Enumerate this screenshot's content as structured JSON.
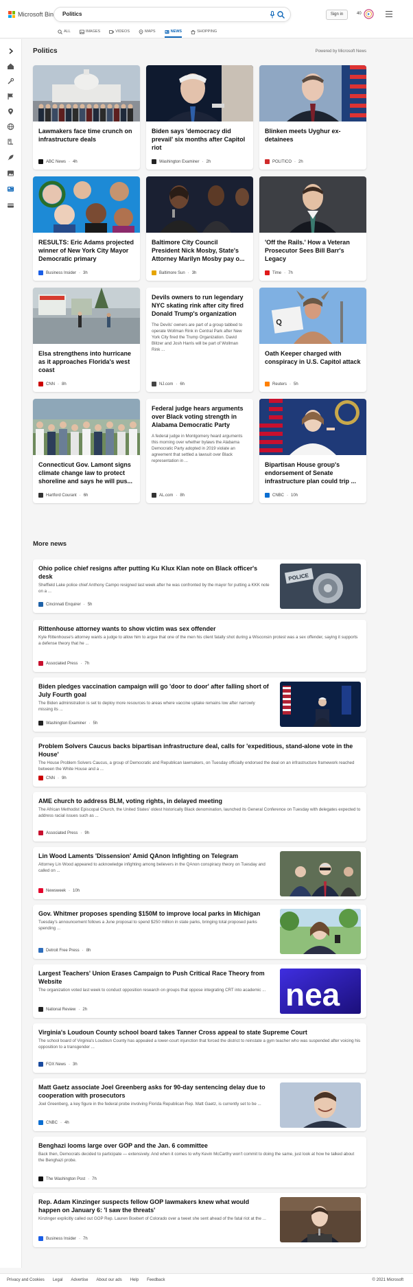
{
  "header": {
    "logo_text": "Microsoft Bing",
    "search_value": "Politics",
    "signin_label": "Sign in",
    "rewards_count": "40",
    "tabs": [
      {
        "label": "ALL",
        "icon": "search-icon"
      },
      {
        "label": "IMAGES",
        "icon": "image-icon"
      },
      {
        "label": "VIDEOS",
        "icon": "video-icon"
      },
      {
        "label": "MAPS",
        "icon": "map-pin-icon"
      },
      {
        "label": "NEWS",
        "icon": "news-icon",
        "active": true
      },
      {
        "label": "SHOPPING",
        "icon": "shopping-bag-icon"
      }
    ]
  },
  "colors": {
    "accent": "#0d66b8",
    "ms_red": "#f25022",
    "ms_green": "#7fba00",
    "ms_blue": "#00a4ef",
    "ms_yellow": "#ffb900"
  },
  "rail_icons": [
    "chevron-right-icon",
    "home-icon",
    "tools-icon",
    "flag-icon",
    "location-icon",
    "globe-icon",
    "education-icon",
    "rocket-icon",
    "gallery-icon",
    "news-icon",
    "card-icon"
  ],
  "section": {
    "title": "Politics",
    "powered_by": "Powered by Microsoft News"
  },
  "cards": [
    {
      "title": "Lawmakers face time crunch on infrastructure deals",
      "source": "ABC News",
      "time": "4h",
      "image": "capitol-group-photo"
    },
    {
      "title": "Biden says 'democracy did prevail' six months after Capitol riot",
      "source": "Washington Examiner",
      "time": "2h",
      "image": "biden-speaking-photo"
    },
    {
      "title": "Blinken meets Uyghur ex-detainees",
      "source": "POLITICO",
      "time": "2h",
      "image": "blinken-photo"
    },
    {
      "title": "RESULTS: Eric Adams projected winner of New York City Mayor Democratic primary",
      "source": "Business Insider",
      "time": "3h",
      "image": "candidates-collage"
    },
    {
      "title": "Baltimore City Council President Nick Mosby, State's Attorney Marilyn Mosby pay o...",
      "source": "Baltimore Sun",
      "time": "3h",
      "image": "mosby-podium-photo"
    },
    {
      "title": "'Off the Rails.' How a Veteran Prosecutor Sees Bill Barr's Legacy",
      "source": "Time",
      "time": "7h",
      "image": "man-in-suit-photo"
    },
    {
      "title": "Elsa strengthens into hurricane as it approaches Florida's west coast",
      "source": "CNN",
      "time": "8h",
      "image": "flooded-street-photo"
    },
    {
      "title": "Devils owners to run legendary NYC skating rink after city fired Donald Trump's organization",
      "snippet": "The Devils' owners are part of a group tabbed to operate Wollman Rink in Central Park after New York City fired the Trump Organization. David Blitzer and Josh Harris will be part of Wollman Rink ...",
      "source": "NJ.com",
      "time": "6h"
    },
    {
      "title": "Oath Keeper charged with conspiracy in U.S. Capitol attack",
      "source": "Reuters",
      "time": "5h",
      "image": "protester-horns-photo"
    },
    {
      "title": "Connecticut Gov. Lamont signs climate change law to protect shoreline and says he will pus...",
      "source": "Hartford Courant",
      "time": "6h",
      "image": "outdoor-group-photo"
    },
    {
      "title": "Federal judge hears arguments over Black voting strength in Alabama Democratic Party",
      "snippet": "A federal judge in Montgomery heard arguments this morning over whether bylaws the Alabama Democratic Party adopted in 2019 violate an agreement that settled a lawsuit over Black representation in ...",
      "source": "AL.com",
      "time": "8h"
    },
    {
      "title": "Bipartisan House group's endorsement of Senate infrastructure plan could trip ...",
      "source": "CNBC",
      "time": "10h",
      "image": "pelosi-photo"
    }
  ],
  "more_news": {
    "title": "More news",
    "items": [
      {
        "title": "Ohio police chief resigns after putting Ku Klux Klan note on Black officer's desk",
        "snippet": "Sheffield Lake police chief Anthony Campo resigned last week after he was confronted by the mayor for putting a KKK note on a ...",
        "source": "Cincinnati Enquirer",
        "time": "5h",
        "image": "police-badge-photo"
      },
      {
        "title": "Rittenhouse attorney wants to show victim was sex offender",
        "snippet": "Kyle Rittenhouse's attorney wants a judge to allow him to argue that one of the men his client fatally shot during a Wisconsin protest was a sex offender, saying it supports a defense theory that he ...",
        "source": "Associated Press",
        "time": "7h"
      },
      {
        "title": "Biden pledges vaccination campaign will go 'door to door' after falling short of July Fourth goal",
        "snippet": "The Biden administration is set to deploy more resources to areas where vaccine uptake remains low after narrowly missing its ...",
        "source": "Washington Examiner",
        "time": "5h",
        "image": "biden-flags-photo"
      },
      {
        "title": "Problem Solvers Caucus backs bipartisan infrastructure deal, calls for 'expeditious, stand-alone vote in the House'",
        "snippet": "The House Problem Solvers Caucus, a group of Democratic and Republican lawmakers, on Tuesday officially endorsed the deal on an infrastructure framework reached between the White House and a ...",
        "source": "CNN",
        "time": "9h"
      },
      {
        "title": "AME church to address BLM, voting rights, in delayed meeting",
        "snippet": "The African Methodist Episcopal Church, the United States' oldest historically Black denomination, launched its General Conference on Tuesday with delegates expected to address racial issues such as ...",
        "source": "Associated Press",
        "time": "9h"
      },
      {
        "title": "Lin Wood Laments 'Dissension' Amid QAnon Infighting on Telegram",
        "snippet": "Attorney Lin Wood appeared to acknowledge infighting among believers in the QAnon conspiracy theory on Tuesday and called on ...",
        "source": "Newsweek",
        "time": "10h",
        "image": "lin-wood-photo"
      },
      {
        "title": "Gov. Whitmer proposes spending $150M to improve local parks in Michigan",
        "snippet": "Tuesday's announcement follows a June proposal to spend $250 million in state parks, bringing total proposed parks spending ...",
        "source": "Detroit Free Press",
        "time": "8h",
        "image": "whitmer-park-photo"
      },
      {
        "title": "Largest Teachers' Union Erases Campaign to Push Critical Race Theory from Website",
        "snippet": "The organization voted last week to conduct opposition research on groups that oppose integrating CRT into academic ...",
        "source": "National Review",
        "time": "2h",
        "image": "nea-logo-photo",
        "image_text": "nea"
      },
      {
        "title": "Virginia's Loudoun County school board takes Tanner Cross appeal to state Supreme Court",
        "snippet": "The school board of Virginia's Loudoun County has appealed a lower-court injunction that forced the district to reinstate a gym teacher who was suspended after voicing his opposition to a transgender ...",
        "source": "FOX News",
        "time": "3h"
      },
      {
        "title": "Matt Gaetz associate Joel Greenberg asks for 90-day sentencing delay due to cooperation with prosecutors",
        "snippet": "Joel Greenberg, a key figure in the federal probe involving Florida Republican Rep. Matt Gaetz, is currently set to be ...",
        "source": "CNBC",
        "time": "4h",
        "image": "greenberg-photo"
      },
      {
        "title": "Benghazi looms large over GOP and the Jan. 6 committee",
        "snippet": "Back then, Democrats decided to participate — extensively. And when it comes to why Kevin McCarthy won't commit to doing the same, just look at how he talked about the Benghazi probe.",
        "source": "The Washington Post",
        "time": "7h"
      },
      {
        "title": "Rep. Adam Kinzinger suspects fellow GOP lawmakers knew what would happen on January 6: 'I saw the threats'",
        "snippet": "Kinzinger explicitly called out GOP Rep. Lauren Boebert of Colorado over a tweet she sent ahead of the fatal riot at the ...",
        "source": "Business Insider",
        "time": "7h",
        "image": "kinzinger-photo"
      }
    ]
  },
  "footer": {
    "links": [
      "Privacy and Cookies",
      "Legal",
      "Advertise",
      "About our ads",
      "Help",
      "Feedback"
    ],
    "copyright": "© 2021 Microsoft"
  }
}
